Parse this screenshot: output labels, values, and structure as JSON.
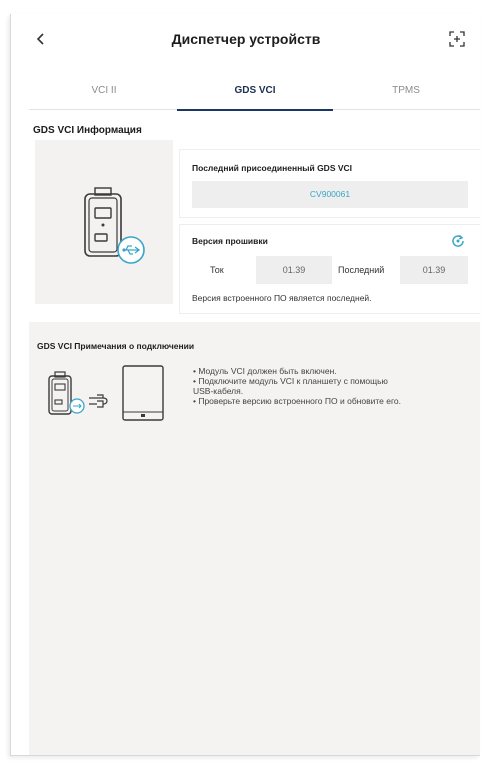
{
  "header": {
    "title": "Диспетчер устройств",
    "back_icon": "chevron-left-icon",
    "scan_icon": "scan-frame-icon"
  },
  "tabs": [
    {
      "label": "VCI II",
      "active": false
    },
    {
      "label": "GDS VCI",
      "active": true
    },
    {
      "label": "TPMS",
      "active": false
    }
  ],
  "info": {
    "section_title": "GDS VCI Информация",
    "last_connected_title": "Последний присоединенный GDS VCI",
    "serial": "CV900061",
    "firmware_title": "Версия прошивки",
    "current_label": "Ток",
    "current_value": "01.39",
    "latest_label": "Последний",
    "latest_value": "01.39",
    "status_message": "Версия встроенного ПО является последней."
  },
  "notes": {
    "title": "GDS VCI Примечания о подключении",
    "items": [
      "• Модуль VCI должен быть включен.",
      "• Подключите модуль VCI к планшету с помощью",
      "USB-кабеля.",
      "• Проверьте версию встроенного ПО и обновите его."
    ]
  },
  "colors": {
    "accent": "#39a6c8",
    "tab_active": "#1b3662",
    "panel_bg": "#f4f1f1",
    "field_bg": "#eeeeee"
  }
}
